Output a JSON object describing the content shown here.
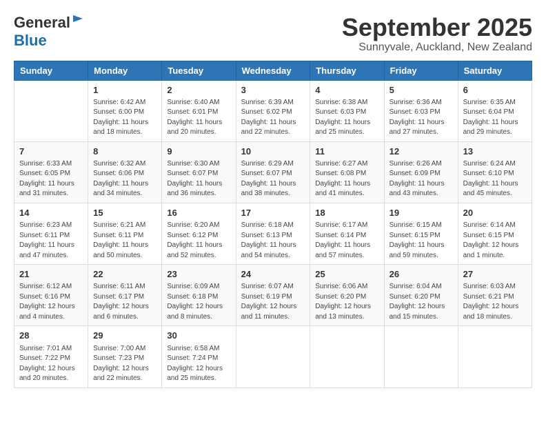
{
  "header": {
    "logo_general": "General",
    "logo_blue": "Blue",
    "month_title": "September 2025",
    "location": "Sunnyvale, Auckland, New Zealand"
  },
  "weekdays": [
    "Sunday",
    "Monday",
    "Tuesday",
    "Wednesday",
    "Thursday",
    "Friday",
    "Saturday"
  ],
  "weeks": [
    [
      {
        "day": "",
        "sunrise": "",
        "sunset": "",
        "daylight": ""
      },
      {
        "day": "1",
        "sunrise": "Sunrise: 6:42 AM",
        "sunset": "Sunset: 6:00 PM",
        "daylight": "Daylight: 11 hours and 18 minutes."
      },
      {
        "day": "2",
        "sunrise": "Sunrise: 6:40 AM",
        "sunset": "Sunset: 6:01 PM",
        "daylight": "Daylight: 11 hours and 20 minutes."
      },
      {
        "day": "3",
        "sunrise": "Sunrise: 6:39 AM",
        "sunset": "Sunset: 6:02 PM",
        "daylight": "Daylight: 11 hours and 22 minutes."
      },
      {
        "day": "4",
        "sunrise": "Sunrise: 6:38 AM",
        "sunset": "Sunset: 6:03 PM",
        "daylight": "Daylight: 11 hours and 25 minutes."
      },
      {
        "day": "5",
        "sunrise": "Sunrise: 6:36 AM",
        "sunset": "Sunset: 6:03 PM",
        "daylight": "Daylight: 11 hours and 27 minutes."
      },
      {
        "day": "6",
        "sunrise": "Sunrise: 6:35 AM",
        "sunset": "Sunset: 6:04 PM",
        "daylight": "Daylight: 11 hours and 29 minutes."
      }
    ],
    [
      {
        "day": "7",
        "sunrise": "Sunrise: 6:33 AM",
        "sunset": "Sunset: 6:05 PM",
        "daylight": "Daylight: 11 hours and 31 minutes."
      },
      {
        "day": "8",
        "sunrise": "Sunrise: 6:32 AM",
        "sunset": "Sunset: 6:06 PM",
        "daylight": "Daylight: 11 hours and 34 minutes."
      },
      {
        "day": "9",
        "sunrise": "Sunrise: 6:30 AM",
        "sunset": "Sunset: 6:07 PM",
        "daylight": "Daylight: 11 hours and 36 minutes."
      },
      {
        "day": "10",
        "sunrise": "Sunrise: 6:29 AM",
        "sunset": "Sunset: 6:07 PM",
        "daylight": "Daylight: 11 hours and 38 minutes."
      },
      {
        "day": "11",
        "sunrise": "Sunrise: 6:27 AM",
        "sunset": "Sunset: 6:08 PM",
        "daylight": "Daylight: 11 hours and 41 minutes."
      },
      {
        "day": "12",
        "sunrise": "Sunrise: 6:26 AM",
        "sunset": "Sunset: 6:09 PM",
        "daylight": "Daylight: 11 hours and 43 minutes."
      },
      {
        "day": "13",
        "sunrise": "Sunrise: 6:24 AM",
        "sunset": "Sunset: 6:10 PM",
        "daylight": "Daylight: 11 hours and 45 minutes."
      }
    ],
    [
      {
        "day": "14",
        "sunrise": "Sunrise: 6:23 AM",
        "sunset": "Sunset: 6:11 PM",
        "daylight": "Daylight: 11 hours and 47 minutes."
      },
      {
        "day": "15",
        "sunrise": "Sunrise: 6:21 AM",
        "sunset": "Sunset: 6:11 PM",
        "daylight": "Daylight: 11 hours and 50 minutes."
      },
      {
        "day": "16",
        "sunrise": "Sunrise: 6:20 AM",
        "sunset": "Sunset: 6:12 PM",
        "daylight": "Daylight: 11 hours and 52 minutes."
      },
      {
        "day": "17",
        "sunrise": "Sunrise: 6:18 AM",
        "sunset": "Sunset: 6:13 PM",
        "daylight": "Daylight: 11 hours and 54 minutes."
      },
      {
        "day": "18",
        "sunrise": "Sunrise: 6:17 AM",
        "sunset": "Sunset: 6:14 PM",
        "daylight": "Daylight: 11 hours and 57 minutes."
      },
      {
        "day": "19",
        "sunrise": "Sunrise: 6:15 AM",
        "sunset": "Sunset: 6:15 PM",
        "daylight": "Daylight: 11 hours and 59 minutes."
      },
      {
        "day": "20",
        "sunrise": "Sunrise: 6:14 AM",
        "sunset": "Sunset: 6:15 PM",
        "daylight": "Daylight: 12 hours and 1 minute."
      }
    ],
    [
      {
        "day": "21",
        "sunrise": "Sunrise: 6:12 AM",
        "sunset": "Sunset: 6:16 PM",
        "daylight": "Daylight: 12 hours and 4 minutes."
      },
      {
        "day": "22",
        "sunrise": "Sunrise: 6:11 AM",
        "sunset": "Sunset: 6:17 PM",
        "daylight": "Daylight: 12 hours and 6 minutes."
      },
      {
        "day": "23",
        "sunrise": "Sunrise: 6:09 AM",
        "sunset": "Sunset: 6:18 PM",
        "daylight": "Daylight: 12 hours and 8 minutes."
      },
      {
        "day": "24",
        "sunrise": "Sunrise: 6:07 AM",
        "sunset": "Sunset: 6:19 PM",
        "daylight": "Daylight: 12 hours and 11 minutes."
      },
      {
        "day": "25",
        "sunrise": "Sunrise: 6:06 AM",
        "sunset": "Sunset: 6:20 PM",
        "daylight": "Daylight: 12 hours and 13 minutes."
      },
      {
        "day": "26",
        "sunrise": "Sunrise: 6:04 AM",
        "sunset": "Sunset: 6:20 PM",
        "daylight": "Daylight: 12 hours and 15 minutes."
      },
      {
        "day": "27",
        "sunrise": "Sunrise: 6:03 AM",
        "sunset": "Sunset: 6:21 PM",
        "daylight": "Daylight: 12 hours and 18 minutes."
      }
    ],
    [
      {
        "day": "28",
        "sunrise": "Sunrise: 7:01 AM",
        "sunset": "Sunset: 7:22 PM",
        "daylight": "Daylight: 12 hours and 20 minutes."
      },
      {
        "day": "29",
        "sunrise": "Sunrise: 7:00 AM",
        "sunset": "Sunset: 7:23 PM",
        "daylight": "Daylight: 12 hours and 22 minutes."
      },
      {
        "day": "30",
        "sunrise": "Sunrise: 6:58 AM",
        "sunset": "Sunset: 7:24 PM",
        "daylight": "Daylight: 12 hours and 25 minutes."
      },
      {
        "day": "",
        "sunrise": "",
        "sunset": "",
        "daylight": ""
      },
      {
        "day": "",
        "sunrise": "",
        "sunset": "",
        "daylight": ""
      },
      {
        "day": "",
        "sunrise": "",
        "sunset": "",
        "daylight": ""
      },
      {
        "day": "",
        "sunrise": "",
        "sunset": "",
        "daylight": ""
      }
    ]
  ]
}
